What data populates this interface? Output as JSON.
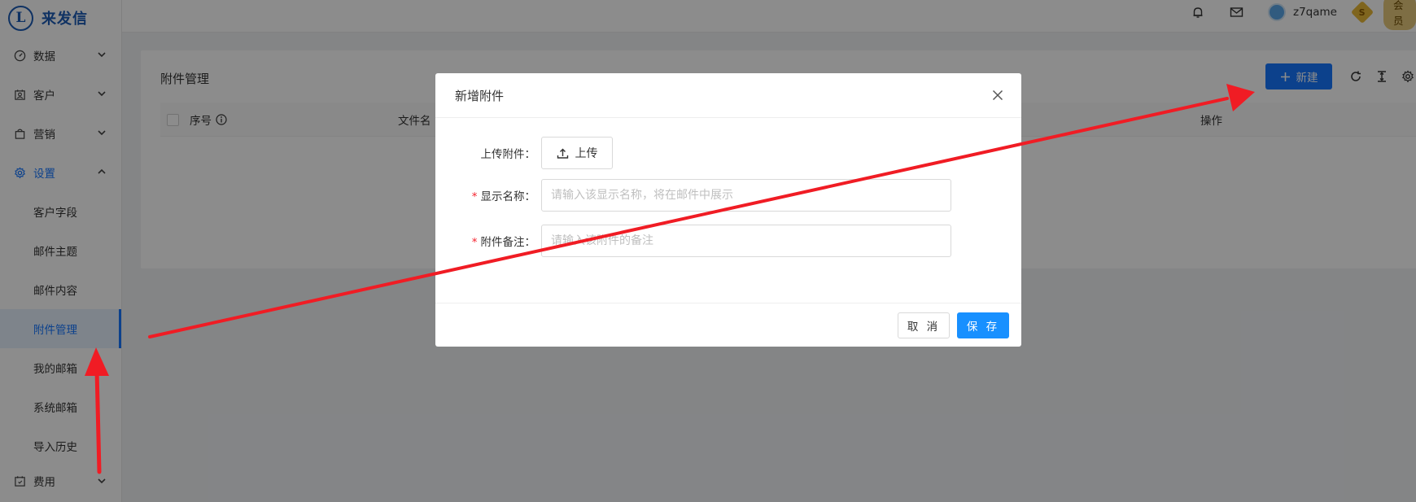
{
  "app": {
    "logo_mark": "L",
    "name": "来发信"
  },
  "sidebar": {
    "items": [
      {
        "label": "数据",
        "icon": "dashboard-icon"
      },
      {
        "label": "客户",
        "icon": "contacts-icon"
      },
      {
        "label": "营销",
        "icon": "shopping-bag-icon"
      },
      {
        "label": "设置",
        "icon": "gear-icon"
      }
    ],
    "sub_items": [
      "客户字段",
      "邮件主题",
      "邮件内容",
      "附件管理",
      "我的邮箱",
      "系统邮箱",
      "导入历史"
    ],
    "active_sub_item": "附件管理",
    "bottom_item": {
      "label": "费用",
      "icon": "calendar-icon"
    }
  },
  "topbar": {
    "username": "z7qame",
    "coin_letter": "S",
    "member_label": "会员"
  },
  "page": {
    "title": "附件管理",
    "new_button": "新建",
    "table_headers": {
      "index": "序号",
      "filename": "文件名",
      "operations": "操作"
    }
  },
  "modal": {
    "title": "新增附件",
    "upload_label": "上传附件：",
    "upload_button": "上传",
    "display_name_label": "显示名称：",
    "display_name_placeholder": "请输入该显示名称，将在邮件中展示",
    "note_label": "附件备注：",
    "note_placeholder": "请输入该附件的备注",
    "cancel": "取 消",
    "save": "保 存"
  },
  "colors": {
    "primary": "#1677ff",
    "brand": "#1d5bb5",
    "annotation": "#f01c24"
  }
}
